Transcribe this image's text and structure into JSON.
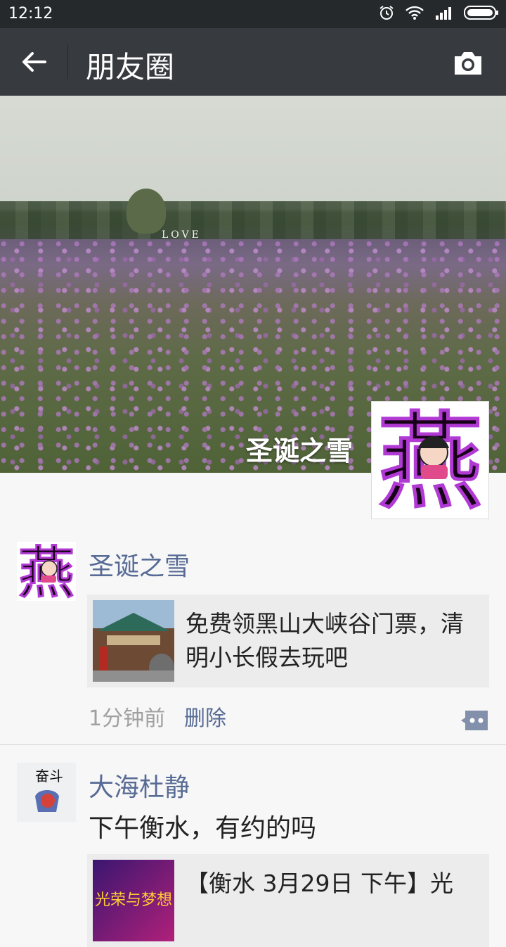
{
  "status": {
    "time": "12:12"
  },
  "nav": {
    "title": "朋友圈"
  },
  "cover": {
    "name": "圣诞之雪",
    "sign_text": "LOVE"
  },
  "posts": [
    {
      "author": "圣诞之雪",
      "link_title": "免费领黑山大峡谷门票，清明小长假去玩吧",
      "time": "1分钟前",
      "delete_label": "删除"
    },
    {
      "author": "大海杜静",
      "text": "下午衡水，有约的吗",
      "link_title": "【衡水 3月29日 下午】光"
    }
  ],
  "avatar_glyph": "燕",
  "post2_avatar_text": "奋斗",
  "post2_thumb_text": "光荣与梦想",
  "colors": {
    "link": "#576b95",
    "nav_bg": "#373a3f",
    "status_bg": "#26292c"
  }
}
